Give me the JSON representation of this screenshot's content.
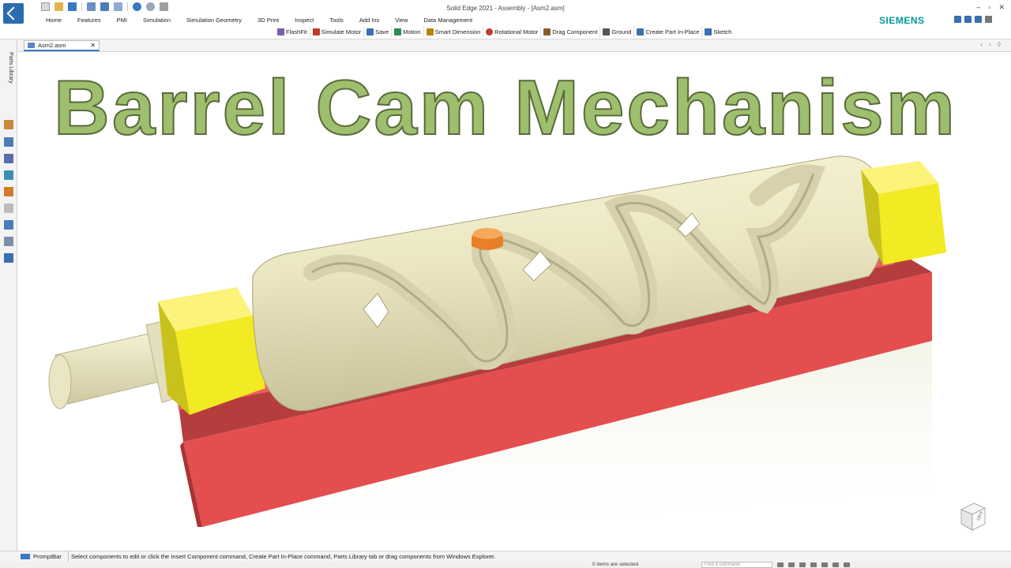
{
  "window": {
    "title": "Solid Edge 2021 - Assembly - [Asm2.asm]",
    "brand": "SIEMENS",
    "controls": [
      "–",
      "▫",
      "✕"
    ]
  },
  "ribbon": {
    "tabs": [
      "Home",
      "Features",
      "PMI",
      "Simulation",
      "Simulation Geometry",
      "3D Print",
      "Inspect",
      "Tools",
      "Add Ins",
      "View",
      "Data Management"
    ],
    "commands": [
      {
        "label": "FlashFit",
        "icon": "flashfit-icon",
        "color": "#7a5ea8"
      },
      {
        "label": "Simulate Motor",
        "icon": "simulate-motor-icon",
        "color": "#c0392b"
      },
      {
        "label": "Save",
        "icon": "save-icon",
        "color": "#3a6fb0"
      },
      {
        "label": "Motion",
        "icon": "motion-icon",
        "color": "#2e8b57"
      },
      {
        "label": "Smart Dimension",
        "icon": "smart-dimension-icon",
        "color": "#b8860b"
      },
      {
        "label": "Rotational Motor",
        "icon": "rotational-motor-icon",
        "color": "#c0392b"
      },
      {
        "label": "Drag Component",
        "icon": "drag-component-icon",
        "color": "#8b5a2b"
      },
      {
        "label": "Ground",
        "icon": "ground-icon",
        "color": "#555555"
      },
      {
        "label": "Create Part In-Place",
        "icon": "create-part-icon",
        "color": "#3a6fb0"
      },
      {
        "label": "Sketch",
        "icon": "sketch-icon",
        "color": "#3a6fb0"
      }
    ]
  },
  "document": {
    "tab_label": "Asm2.asm",
    "close": "✕",
    "nav": "‹ › ◊"
  },
  "sidebar": {
    "label": "Parts Library"
  },
  "viewport": {
    "overlay_title": "Barrel Cam Mechanism",
    "colors": {
      "title_fill": "#9dbf6e",
      "cam_body": "#ece7c2",
      "base": "#e44e4e",
      "end_caps": "#f2ea22",
      "follower_pin": "#e8802a"
    },
    "view_cube_label": "LEFT"
  },
  "prompt": {
    "label": "PromptBar",
    "text": "Select components to edit or click the Insert Component command, Create Part In-Place command, Parts Library tab or drag components from Windows Explorer."
  },
  "status": {
    "selection": "0 items are selected",
    "find_placeholder": "Find a command"
  }
}
